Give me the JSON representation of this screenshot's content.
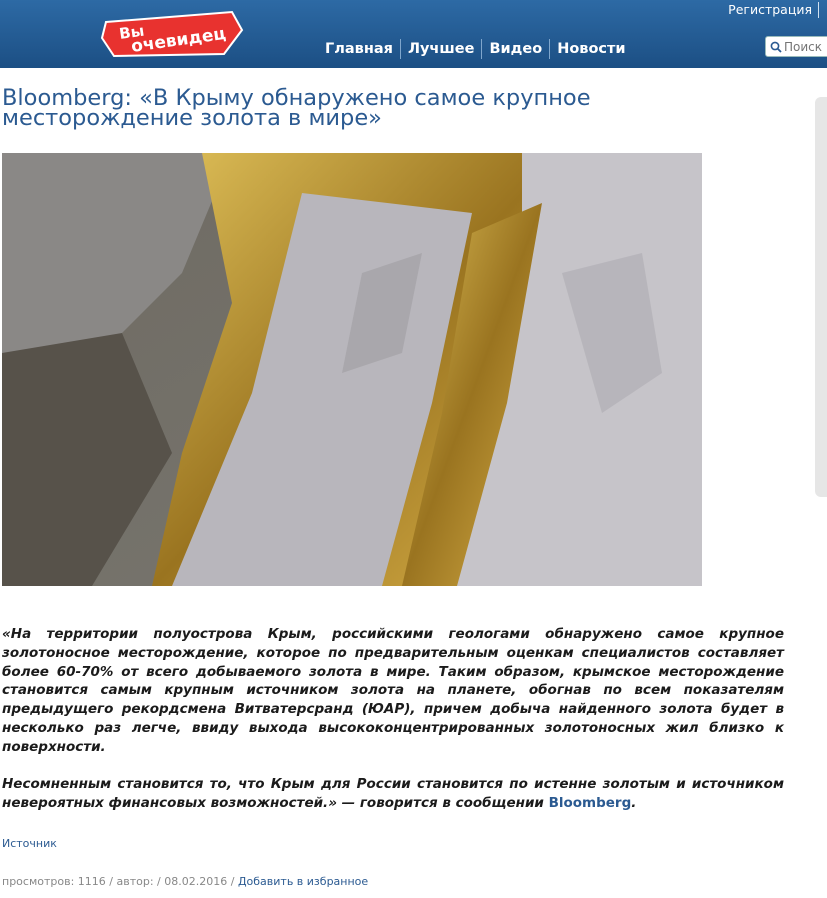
{
  "header": {
    "logo_line1": "Вы",
    "logo_line2": "очевидец",
    "register": "Регистрация",
    "nav": [
      "Главная",
      "Лучшее",
      "Видео",
      "Новости"
    ],
    "search_placeholder": "Поиск"
  },
  "article": {
    "title": "Bloomberg: «В Крыму обнаружено самое крупное месторождение золота в мире»",
    "paragraph1": "«На территории полуострова Крым, российскими геологами обнаружено самое крупное золотоносное месторождение, которое по предварительным оценкам специалистов составляет более 60-70% от всего добываемого золота в мире. Таким образом, крымское месторождение становится самым крупным источником золота на планете, обогнав по всем показателям предыдущего рекордсмена Витватерсранд (ЮАР), причем добыча найденного золота будет в несколько раз легче, ввиду выхода высококонцентрированных золотоносных жил близко к поверхности.",
    "paragraph2_text": "Несомненным становится то, что Крым для России становится по истенне золотым и источником невероятных финансовых возможностей.» — говорится в сообщении ",
    "paragraph2_link": "Bloomberg",
    "paragraph2_end": ".",
    "source": "Источник"
  },
  "meta": {
    "views_label": "просмотров: ",
    "views": "1116",
    "sep1": " / ",
    "author_label": "автор: ",
    "sep2": " / ",
    "date": "08.02.2016",
    "sep3": " / ",
    "favorite": "Добавить в избранное"
  },
  "colors": {
    "header": "#1c4f84",
    "logo": "#e8322f",
    "link": "#2b5a91"
  },
  "icons": {
    "search": "magnifier-icon"
  }
}
